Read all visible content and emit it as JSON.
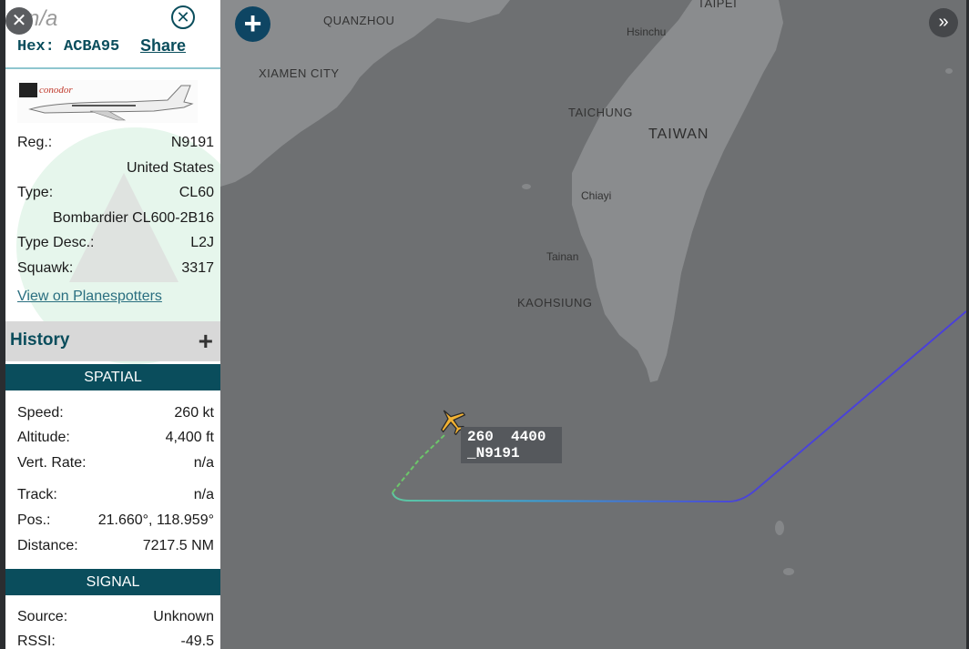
{
  "window_controls": {
    "close_symbol": "✕",
    "expand_symbol": "»"
  },
  "sidebar": {
    "callsign": "n/a",
    "hex_label": "Hex: ACBA95",
    "share_label": "Share",
    "close_icon": "close-icon",
    "thumbnail_logo_text": "conodor",
    "details": [
      {
        "label": "Reg.:",
        "value": "N9191"
      },
      {
        "label": "",
        "value": "United States"
      },
      {
        "label": "Type:",
        "value": "CL60"
      },
      {
        "label": "",
        "value": "Bombardier CL600-2B16"
      },
      {
        "label": "Type Desc.:",
        "value": "L2J"
      },
      {
        "label": "Squawk:",
        "value": "3317"
      }
    ],
    "planespotters_link": "View on Planespotters",
    "history_title": "History",
    "history_toggle": "+",
    "spatial_title": "SPATIAL",
    "spatial": [
      {
        "label": "Speed:",
        "value": "260 kt"
      },
      {
        "label": "Altitude:",
        "value": "4,400 ft"
      },
      {
        "label": "Vert. Rate:",
        "value": "n/a"
      },
      {
        "label": "Track:",
        "value": "n/a"
      },
      {
        "label": "Pos.:",
        "value": "21.660°, 118.959°"
      },
      {
        "label": "Distance:",
        "value": "7217.5 NM"
      }
    ],
    "signal_title": "SIGNAL",
    "signal": [
      {
        "label": "Source:",
        "value": "Unknown"
      },
      {
        "label": "RSSI:",
        "value": "-49.5"
      }
    ]
  },
  "map": {
    "zoom_in_label": "+",
    "places": {
      "taipei": "TAIPEI",
      "quanzhou": "QUANZHOU",
      "hsinchu": "Hsinchu",
      "xiamen": "XIAMEN CITY",
      "taichung": "TAICHUNG",
      "taiwan": "TAIWAN",
      "chiayi": "Chiayi",
      "tainan": "Tainan",
      "kaohsiung": "KAOHSIUNG"
    },
    "aircraft_label": {
      "line1": "260  4400",
      "line2": "_N9191"
    },
    "track_colors": {
      "start": "#c8d23a",
      "mid": "#3fbfa0",
      "end": "#4a3fd9"
    },
    "land_color": "#8a8c8e",
    "sea_color": "#6e7072"
  }
}
